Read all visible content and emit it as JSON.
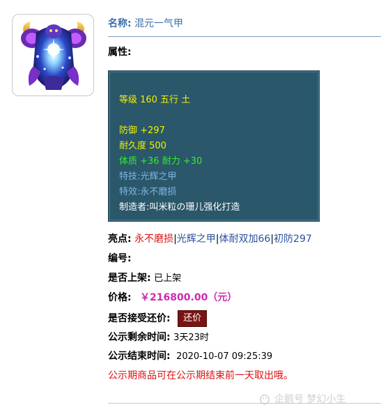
{
  "item": {
    "name_label": "名称:",
    "name_value": "混元一气甲",
    "attr_label": "属性:"
  },
  "panel": {
    "level_line": "等级 160 五行 土",
    "defense_line": "防御 +297",
    "durability_line": "耐久度 500",
    "stats_line": "体质 +36 耐力 +30",
    "skill_line": "特技:光辉之甲",
    "effect_line": "特效:永不磨损",
    "maker_line": "制造者:叫米粒の珊儿强化打造"
  },
  "fields": {
    "highlight_label": "亮点:",
    "highlight_parts": [
      "永不磨损",
      "|",
      "光辉之甲",
      "|",
      "体耐双加66",
      "|",
      "初防297"
    ],
    "number_label": "编号:",
    "listed_label": "是否上架:",
    "listed_value": "已上架",
    "price_label": "价格:",
    "price_value": "￥216800.00（元）",
    "counter_label": "是否接受还价:",
    "counter_button": "还价",
    "remaining_label": "公示剩余时间:",
    "remaining_value": "3天23时",
    "end_label": "公示结束时间:",
    "end_value": "2020-10-07 09:25:39",
    "notice": "公示期商品可在公示期结束前一天取出哦。"
  },
  "watermark": "企鹅号 梦幻小生",
  "colors": {
    "panel_bg": "#2a5769",
    "price": "#cc2ab0",
    "highlight_red": "#dd1111",
    "button_bg": "#7a1313"
  },
  "icons": {
    "item_image": "armor-item-icon",
    "watermark": "penguin-logo-icon"
  }
}
